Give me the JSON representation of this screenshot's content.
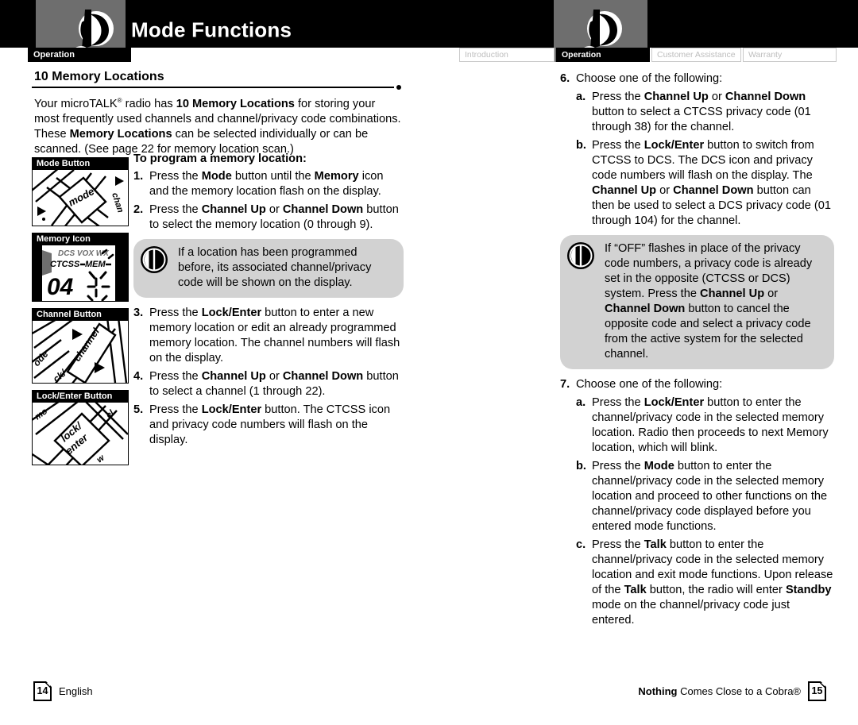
{
  "header": {
    "title": "Mode Functions",
    "left_tab": "Operation",
    "tabs": [
      {
        "label": "Introduction",
        "active": false
      },
      {
        "label": "Operation",
        "active": true
      },
      {
        "label": "Customer Assistance",
        "active": false
      },
      {
        "label": "Warranty",
        "active": false
      }
    ],
    "logo_alt": "cobra-radio-logo"
  },
  "left": {
    "section_title": "10 Memory Locations",
    "intro_parts": [
      {
        "t": "Your microTALK",
        "b": false
      },
      {
        "t": "®",
        "sup": true
      },
      {
        "t": " radio has ",
        "b": false
      },
      {
        "t": "10 Memory Locations",
        "b": true
      },
      {
        "t": " for storing your most frequently used channels and channel/privacy code combinations. These ",
        "b": false
      },
      {
        "t": "Memory Locations",
        "b": true
      },
      {
        "t": " can be selected individually or can be scanned. (See page 22 for memory location scan.)",
        "b": false
      }
    ],
    "figures": [
      {
        "caption": "Mode Button",
        "image": "mode-button-photo"
      },
      {
        "caption": "Memory Icon",
        "image": "memory-icon-lcd"
      },
      {
        "caption": "Channel Button",
        "image": "channel-button-photo"
      },
      {
        "caption": "Lock/Enter Button",
        "image": "lock-enter-button-photo"
      }
    ],
    "lcd_labels": {
      "row1": "DCS VOX WX",
      "ctcss": "CTCSS",
      "mem": "MEM",
      "digits": "04"
    },
    "sub_head": "To program a memory location:",
    "steps": [
      {
        "num": "1.",
        "parts": [
          {
            "t": "Press the ",
            "b": false
          },
          {
            "t": "Mode",
            "b": true
          },
          {
            "t": " button until the ",
            "b": false
          },
          {
            "t": "Memory",
            "b": true
          },
          {
            "t": " icon and the memory location flash on the display.",
            "b": false
          }
        ]
      },
      {
        "num": "2.",
        "parts": [
          {
            "t": "Press the ",
            "b": false
          },
          {
            "t": "Channel Up",
            "b": true
          },
          {
            "t": " or ",
            "b": false
          },
          {
            "t": "Channel Down",
            "b": true
          },
          {
            "t": " button to select the memory location (0 through 9).",
            "b": false
          }
        ]
      }
    ],
    "note": "If a location has been programmed before, its associated channel/privacy code will be shown on the display.",
    "steps2": [
      {
        "num": "3.",
        "parts": [
          {
            "t": "Press the ",
            "b": false
          },
          {
            "t": "Lock/Enter",
            "b": true
          },
          {
            "t": " button to enter a new memory location or edit an already programmed memory location. The channel numbers will flash on the display.",
            "b": false
          }
        ]
      },
      {
        "num": "4.",
        "parts": [
          {
            "t": "Press the ",
            "b": false
          },
          {
            "t": "Channel Up",
            "b": true
          },
          {
            "t": " or ",
            "b": false
          },
          {
            "t": "Channel Down",
            "b": true
          },
          {
            "t": " button to select a channel (1 through 22).",
            "b": false
          }
        ]
      },
      {
        "num": "5.",
        "parts": [
          {
            "t": "Press the ",
            "b": false
          },
          {
            "t": "Lock/Enter",
            "b": true
          },
          {
            "t": " button. The CTCSS icon and privacy code numbers will flash on the display.",
            "b": false
          }
        ]
      }
    ]
  },
  "right": {
    "step6": {
      "num": "6.",
      "label": "Choose one of the following:",
      "subs": [
        {
          "num": "a.",
          "parts": [
            {
              "t": "Press the ",
              "b": false
            },
            {
              "t": "Channel Up",
              "b": true
            },
            {
              "t": " or ",
              "b": false
            },
            {
              "t": "Channel Down",
              "b": true
            },
            {
              "t": " button to select a CTCSS privacy code (01 through 38) for the channel.",
              "b": false
            }
          ]
        },
        {
          "num": "b.",
          "parts": [
            {
              "t": "Press the ",
              "b": false
            },
            {
              "t": "Lock/Enter",
              "b": true
            },
            {
              "t": " button to switch from CTCSS to DCS. The DCS icon and privacy code numbers will flash on the display. The ",
              "b": false
            },
            {
              "t": "Channel Up",
              "b": true
            },
            {
              "t": " or ",
              "b": false
            },
            {
              "t": "Channel Down",
              "b": true
            },
            {
              "t": " button can then be used to select a DCS privacy code (01 through 104) for the channel.",
              "b": false
            }
          ]
        }
      ]
    },
    "note_parts": [
      {
        "t": "If “OFF” flashes in place of the privacy code numbers, a privacy code is already set in the opposite (CTCSS or DCS) system. Press the ",
        "b": false
      },
      {
        "t": "Channel Up",
        "b": true
      },
      {
        "t": " or ",
        "b": false
      },
      {
        "t": "Channel Down",
        "b": true
      },
      {
        "t": " button to cancel the opposite code and select a privacy code from the active system for the selected channel.",
        "b": false
      }
    ],
    "step7": {
      "num": "7.",
      "label": "Choose one of the following:",
      "subs": [
        {
          "num": "a.",
          "parts": [
            {
              "t": "Press the ",
              "b": false
            },
            {
              "t": "Lock/Enter",
              "b": true
            },
            {
              "t": " button to enter the channel/privacy code in the selected memory location. Radio then proceeds to next Memory location, which will blink.",
              "b": false
            }
          ]
        },
        {
          "num": "b.",
          "parts": [
            {
              "t": "Press the ",
              "b": false
            },
            {
              "t": "Mode",
              "b": true
            },
            {
              "t": " button to enter the channel/privacy code in the selected memory location and proceed to other functions on the channel/privacy code displayed before you entered mode functions.",
              "b": false
            }
          ]
        },
        {
          "num": "c.",
          "parts": [
            {
              "t": "Press the ",
              "b": false
            },
            {
              "t": "Talk",
              "b": true
            },
            {
              "t": " button to enter the channel/privacy code in the selected memory location and exit mode functions. Upon release of the ",
              "b": false
            },
            {
              "t": "Talk",
              "b": true
            },
            {
              "t": " button, the radio will enter ",
              "b": false
            },
            {
              "t": "Standby",
              "b": true
            },
            {
              "t": " mode on the channel/privacy code just entered.",
              "b": false
            }
          ]
        }
      ]
    }
  },
  "footer": {
    "left_page": "14",
    "left_label": "English",
    "right_tag_bold": "Nothing",
    "right_tag_rest": " Comes Close to a Cobra®",
    "right_page": "15"
  },
  "colors": {
    "black": "#000000",
    "header_gray": "#6e6e6e",
    "note_gray": "#d2d2d2",
    "tab_inactive_text": "#bdbdbd"
  }
}
